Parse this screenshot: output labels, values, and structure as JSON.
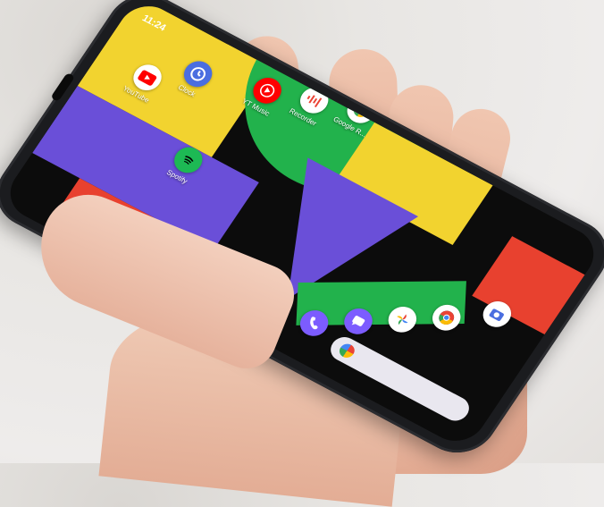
{
  "photo": {
    "subject": "hand-holding-smartphone",
    "colors": {
      "background": "#e8e6e3",
      "skin": "#eab6a0",
      "phone_body": "#1b1c1f"
    }
  },
  "phone_screen": {
    "status_time": "11:24",
    "wallpaper_colors": {
      "yellow": "#f2d32f",
      "green": "#22b24c",
      "purple": "#6a4fd8",
      "red": "#e8412f",
      "black": "#0c0c0c"
    },
    "apps": [
      {
        "id": "youtube",
        "label": "YouTube",
        "icon": "youtube-icon",
        "color": "#ff0000"
      },
      {
        "id": "clock",
        "label": "Clock",
        "icon": "clock-icon",
        "color": "#4a6ee0"
      },
      {
        "id": "yt_music",
        "label": "YT Music",
        "icon": "yt-music-icon",
        "color": "#ff0000"
      },
      {
        "id": "recorder",
        "label": "Recorder",
        "icon": "recorder-icon",
        "color": "#ea4335"
      },
      {
        "id": "google",
        "label": "Google R...",
        "icon": "google-icon",
        "color": "#4285f4"
      },
      {
        "id": "spotify",
        "label": "Spotify",
        "icon": "spotify-icon",
        "color": "#1db954"
      }
    ],
    "dock": [
      {
        "id": "phone",
        "icon": "phone-icon",
        "color": "#7c5cff"
      },
      {
        "id": "messages",
        "icon": "messages-icon",
        "color": "#7c5cff"
      },
      {
        "id": "photos",
        "icon": "photos-icon",
        "color": "#ffffff"
      },
      {
        "id": "chrome",
        "icon": "chrome-icon",
        "color": "#ffffff"
      },
      {
        "id": "camera",
        "icon": "camera-icon",
        "color": "#ffffff"
      }
    ]
  }
}
